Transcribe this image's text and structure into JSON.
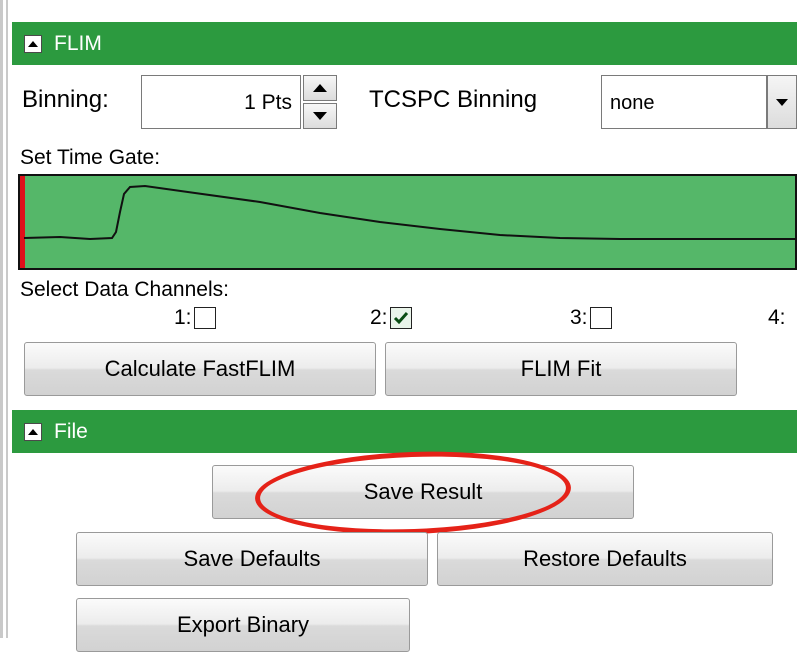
{
  "flim": {
    "section_title": "FLIM",
    "binning_label": "Binning:",
    "binning_value": "1 Pts",
    "tcspc_label": "TCSPC Binning",
    "tcspc_value": "none",
    "time_gate_label": "Set Time Gate:",
    "channels_label": "Select Data Channels:",
    "channels": [
      {
        "label": "1:",
        "checked": false
      },
      {
        "label": "2:",
        "checked": true
      },
      {
        "label": "3:",
        "checked": false
      },
      {
        "label": "4:",
        "checked": false
      }
    ],
    "calc_button": "Calculate FastFLIM",
    "fit_button": "FLIM Fit"
  },
  "file": {
    "section_title": "File",
    "save_result": "Save Result",
    "save_defaults": "Save Defaults",
    "restore_defaults": "Restore Defaults",
    "export_binary": "Export Binary"
  },
  "colors": {
    "section_header": "#2c9a3f",
    "gate_fill": "#55b769",
    "gate_marker": "#e0101a",
    "annotation": "#e52218"
  },
  "icons": {
    "collapse": "triangle-up-icon",
    "spin_up": "arrow-up-icon",
    "spin_down": "arrow-down-icon",
    "dropdown": "chevron-down-icon",
    "check": "checkmark-icon"
  }
}
